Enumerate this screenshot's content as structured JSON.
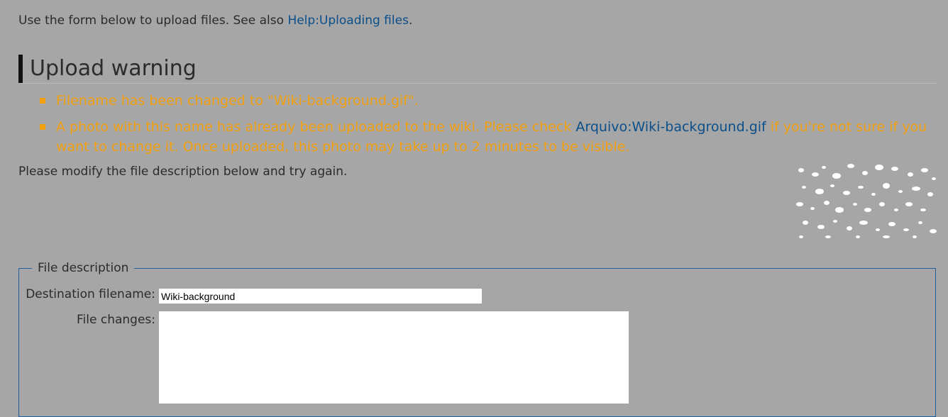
{
  "intro": {
    "text": "Use the form below to upload files. See also ",
    "link": "Help:Uploading files",
    "suffix": "."
  },
  "warning": {
    "heading": "Upload warning",
    "items": [
      {
        "text": "Filename has been changed to \"Wiki-background.gif\"."
      },
      {
        "before": "A photo with this name has already been uploaded to the wiki. Please check ",
        "link": "Arquivo:Wiki-background.gif",
        "after": " if you're not sure if you want to change it. Once uploaded, this photo may take up to 2 minutes to be visible."
      }
    ],
    "retry_text": "Please modify the file description below and try again."
  },
  "form": {
    "legend": "File description",
    "destination_label": "Destination filename:",
    "destination_value": "Wiki-background",
    "changes_label": "File changes:",
    "changes_value": ""
  },
  "colors": {
    "background": "#a6a6a6",
    "warning": "#f4a111",
    "link": "#0b4f8a",
    "fieldset_border": "#1f5fa0"
  }
}
